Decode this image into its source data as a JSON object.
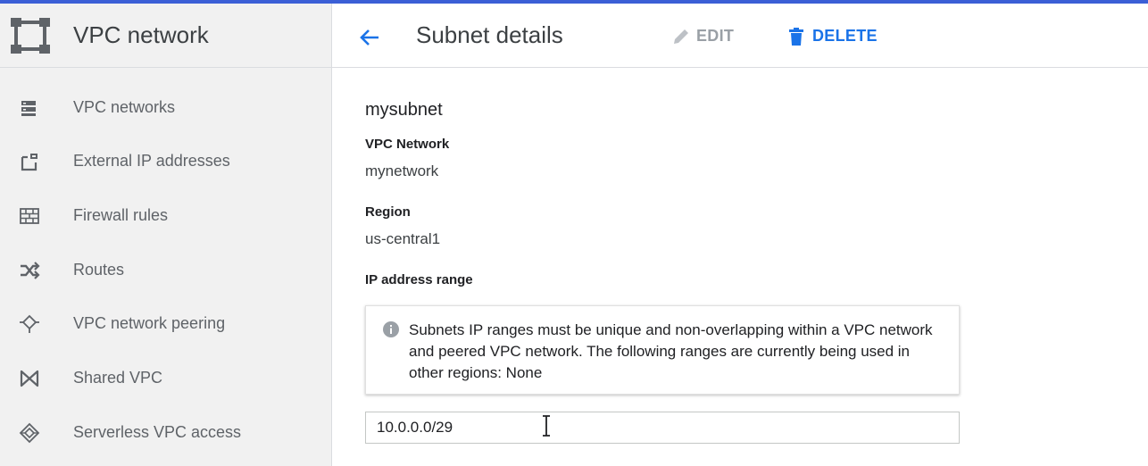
{
  "sidebar": {
    "product_title": "VPC network",
    "items": [
      {
        "label": "VPC networks",
        "icon": "vpc-networks-icon"
      },
      {
        "label": "External IP addresses",
        "icon": "external-ip-icon"
      },
      {
        "label": "Firewall rules",
        "icon": "firewall-icon"
      },
      {
        "label": "Routes",
        "icon": "routes-icon"
      },
      {
        "label": "VPC network peering",
        "icon": "peering-icon"
      },
      {
        "label": "Shared VPC",
        "icon": "shared-vpc-icon"
      },
      {
        "label": "Serverless VPC access",
        "icon": "serverless-icon"
      }
    ]
  },
  "header": {
    "title": "Subnet details",
    "edit_label": "EDIT",
    "delete_label": "DELETE"
  },
  "details": {
    "subnet_name": "mysubnet",
    "vpc_network_label": "VPC Network",
    "vpc_network_value": "mynetwork",
    "region_label": "Region",
    "region_value": "us-central1",
    "ip_range_label": "IP address range",
    "info_text": "Subnets IP ranges must be unique and non-overlapping within a VPC network and peered VPC network. The following ranges are currently being used in other regions: None",
    "ip_range_value": "10.0.0.0/29"
  },
  "colors": {
    "accent": "#1a73e8",
    "top_bar": "#3b5fd6",
    "sidebar_bg": "#f1f1f1"
  }
}
